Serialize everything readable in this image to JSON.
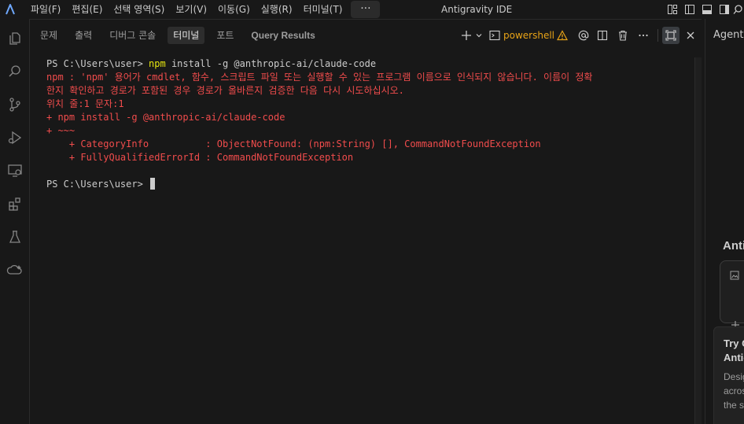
{
  "app": {
    "window_title": "Antigravity IDE",
    "menu": [
      "파일(F)",
      "편집(E)",
      "선택 영역(S)",
      "보기(V)",
      "이동(G)",
      "실행(R)",
      "터미널(T)"
    ],
    "menu_more": "···",
    "accent": "#0078d4"
  },
  "panel": {
    "tabs": [
      "문제",
      "출력",
      "디버그 콘솔",
      "터미널",
      "포트",
      "Query Results"
    ],
    "active_tab": "터미널",
    "terminal_name": "powershell",
    "actions": [
      "plus-icon",
      "chevron-down-icon",
      "terminal-icon",
      "warning-icon",
      "at-icon",
      "split-icon",
      "trash-icon",
      "more-icon",
      "maximize-icon",
      "close-icon"
    ]
  },
  "terminal": {
    "prompt1": "PS C:\\Users\\user> ",
    "cmd_name": "npm",
    "cmd_args": " install -g @anthropic-ai/claude-code",
    "error_line1": "npm : 'npm' 용어가 cmdlet, 함수, 스크립트 파일 또는 실행할 수 있는 프로그램 이름으로 인식되지 않습니다. 이름이 정확",
    "error_line2": "한지 확인하고 경로가 포함된 경우 경로가 올바른지 검증한 다음 다시 시도하십시오.",
    "error_line3": "위치 줄:1 문자:1",
    "error_line4": "+ npm install -g @anthropic-ai/claude-code",
    "error_line5": "+ ~~~",
    "error_line6": "    + CategoryInfo          : ObjectNotFound: (npm:String) [], CommandNotFoundException",
    "error_line7": "    + FullyQualifiedErrorId : CommandNotFoundException",
    "prompt2": "PS C:\\Users\\user> "
  },
  "agent": {
    "tab_label": "Agent",
    "heading": "Anti",
    "card_title": "Try C\nAntic",
    "card_desc": "Desig\nacros\nthe s"
  },
  "activity_icons": [
    "explorer-icon",
    "search-icon",
    "source-control-icon",
    "run-debug-icon",
    "remote-explorer-icon",
    "extensions-icon",
    "testing-icon",
    "cloud-icon"
  ]
}
